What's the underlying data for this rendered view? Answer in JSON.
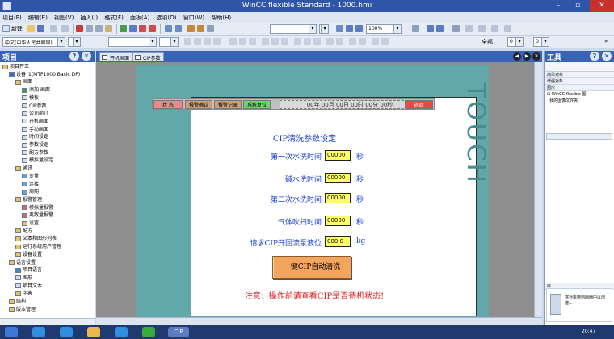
{
  "window": {
    "title": "WinCC flexible Standard - 1000.hmi",
    "minimize": "–",
    "restore": "▫",
    "close": "✕"
  },
  "menu": [
    "项目(P)",
    "编辑(E)",
    "视图(V)",
    "插入(I)",
    "格式(F)",
    "面板(A)",
    "选项(O)",
    "窗口(W)",
    "帮助(H)"
  ],
  "toolbar": {
    "new_label": "新建",
    "zoom_value": "100%",
    "font_value": "中文(中华人民共和国)",
    "all_label": "全部",
    "zero_a": "0",
    "zero_b": "0"
  },
  "project_panel": {
    "title": "项目",
    "items": [
      {
        "label": "项目开立",
        "level": 0,
        "icon": "folder"
      },
      {
        "label": "设备_1(MTP1000 Basic DP)",
        "level": 1,
        "icon": "device"
      },
      {
        "label": "画面",
        "level": 2,
        "icon": "folder"
      },
      {
        "label": "添加 画面",
        "level": 3,
        "icon": "add"
      },
      {
        "label": "模板",
        "level": 3,
        "icon": "screen"
      },
      {
        "label": "CIP参数",
        "level": 3,
        "icon": "screen"
      },
      {
        "label": "公司简介",
        "level": 3,
        "icon": "screen"
      },
      {
        "label": "开机画面",
        "level": 3,
        "icon": "screen"
      },
      {
        "label": "手动画面",
        "level": 3,
        "icon": "screen"
      },
      {
        "label": "时间设定",
        "level": 3,
        "icon": "screen"
      },
      {
        "label": "参数设定",
        "level": 3,
        "icon": "screen"
      },
      {
        "label": "配方参数",
        "level": 3,
        "icon": "screen"
      },
      {
        "label": "模拟量设定",
        "level": 3,
        "icon": "screen"
      },
      {
        "label": "通讯",
        "level": 2,
        "icon": "folder"
      },
      {
        "label": "变量",
        "level": 3,
        "icon": "tag"
      },
      {
        "label": "连接",
        "level": 3,
        "icon": "tag"
      },
      {
        "label": "周期",
        "level": 3,
        "icon": "tag"
      },
      {
        "label": "报警管理",
        "level": 2,
        "icon": "folder"
      },
      {
        "label": "模拟量报警",
        "level": 3,
        "icon": "alarm"
      },
      {
        "label": "离散量报警",
        "level": 3,
        "icon": "alarm"
      },
      {
        "label": "设置",
        "level": 3,
        "icon": "folder"
      },
      {
        "label": "配方",
        "level": 2,
        "icon": "folder"
      },
      {
        "label": "文本和图形列表",
        "level": 2,
        "icon": "folder"
      },
      {
        "label": "运行系统用户管理",
        "level": 2,
        "icon": "folder"
      },
      {
        "label": "设备设置",
        "level": 2,
        "icon": "folder"
      },
      {
        "label": "语言设置",
        "level": 1,
        "icon": "folder"
      },
      {
        "label": "项目语言",
        "level": 2,
        "icon": "globe"
      },
      {
        "label": "图形",
        "level": 2,
        "icon": "screen"
      },
      {
        "label": "项目文本",
        "level": 2,
        "icon": "screen"
      },
      {
        "label": "字典",
        "level": 2,
        "icon": "folder"
      },
      {
        "label": "结构",
        "level": 1,
        "icon": "folder"
      },
      {
        "label": "版本管理",
        "level": 1,
        "icon": "folder"
      }
    ]
  },
  "editor_tabs": [
    {
      "label": "开机画面"
    },
    {
      "label": "CIP参数"
    }
  ],
  "hmi": {
    "device_label": "TOUCH",
    "header_buttons": [
      {
        "label": "状 态",
        "color": "#e88a8a"
      },
      {
        "label": "报警确认",
        "color": "#c8a07a"
      },
      {
        "label": "报警记录",
        "color": "#c8a07a"
      },
      {
        "label": "系统复位",
        "color": "#6fd36f"
      }
    ],
    "date_placeholder": "00年 00月 00日 00时 00分 00秒",
    "back_label": "返回",
    "title": "CIP清洗参数设定",
    "params": [
      {
        "label": "第一次水洗时间",
        "value": "00000",
        "unit": "秒"
      },
      {
        "label": "碱水洗时间",
        "value": "00000",
        "unit": "秒"
      },
      {
        "label": "第二次水洗时间",
        "value": "00000",
        "unit": "秒"
      },
      {
        "label": "气体吹扫时间",
        "value": "00000",
        "unit": "秒"
      },
      {
        "label": "请求CIP开回流泵液位",
        "value": "000.0",
        "unit": "kg"
      }
    ],
    "start_button": "一键CIP自动清洗",
    "warning": "注意：操作前请查看CIP是否待机状态!"
  },
  "tools_panel": {
    "title": "工具",
    "section_simple": "简单对象",
    "section_enhanced": "增强对象",
    "section_graphics": "图形",
    "items": [
      "WinCC flexible 图",
      "我的图像文件夹"
    ],
    "section_bottom": "库",
    "preview_text": "将对象拖到画面中以创建..."
  },
  "taskbar": {
    "clock": "20:47",
    "app_label": "CIP"
  }
}
